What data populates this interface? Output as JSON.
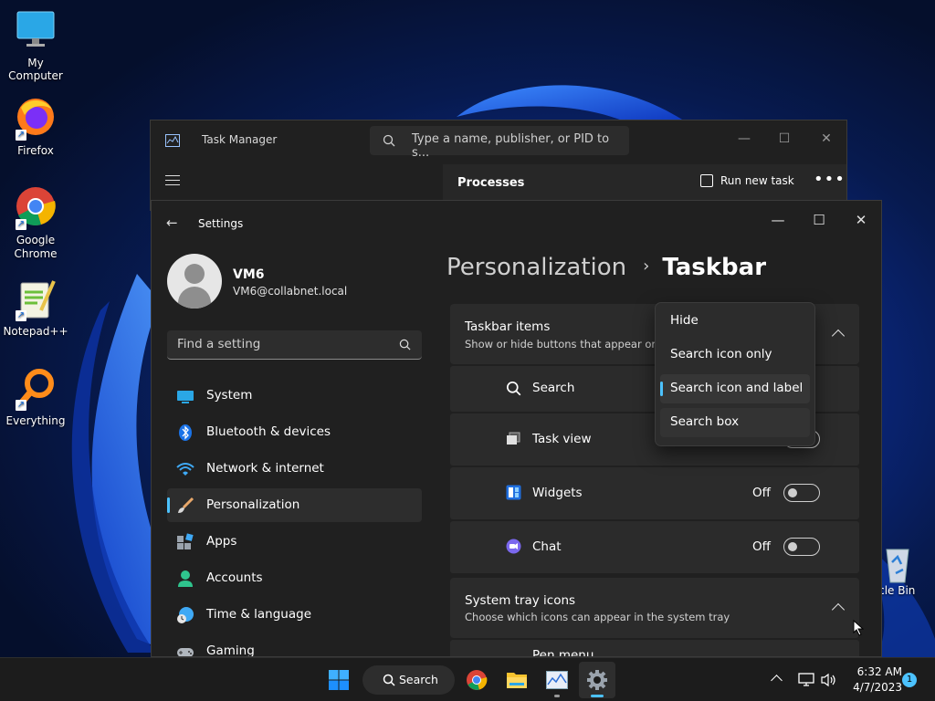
{
  "desktop": {
    "icons": [
      {
        "label": "My Computer",
        "icon": "monitor-icon"
      },
      {
        "label": "Firefox",
        "icon": "firefox-icon"
      },
      {
        "label": "Google\nChrome",
        "icon": "chrome-icon"
      },
      {
        "label": "Notepad++",
        "icon": "notepadpp-icon"
      },
      {
        "label": "Everything",
        "icon": "everything-icon"
      }
    ],
    "recycle_bin_label": "ycle Bin"
  },
  "task_manager": {
    "title": "Task Manager",
    "search_placeholder": "Type a name, publisher, or PID to s...",
    "page": "Processes",
    "run_new_task": "Run new task",
    "more": "•••"
  },
  "settings": {
    "title": "Settings",
    "user": {
      "name": "VM6",
      "email": "VM6@collabnet.local"
    },
    "find_placeholder": "Find a setting",
    "nav": [
      {
        "label": "System",
        "icon": "system-icon",
        "active": false
      },
      {
        "label": "Bluetooth & devices",
        "icon": "bluetooth-icon",
        "active": false
      },
      {
        "label": "Network & internet",
        "icon": "wifi-icon",
        "active": false
      },
      {
        "label": "Personalization",
        "icon": "brush-icon",
        "active": true
      },
      {
        "label": "Apps",
        "icon": "apps-icon",
        "active": false
      },
      {
        "label": "Accounts",
        "icon": "accounts-icon",
        "active": false
      },
      {
        "label": "Time & language",
        "icon": "globe-clock-icon",
        "active": false
      },
      {
        "label": "Gaming",
        "icon": "gamepad-icon",
        "active": false
      }
    ],
    "breadcrumb": {
      "parent": "Personalization",
      "separator": "›",
      "current": "Taskbar"
    },
    "taskbar_items": {
      "title": "Taskbar items",
      "subtitle": "Show or hide buttons that appear on t",
      "rows": [
        {
          "label": "Search",
          "icon": "search-icon",
          "state": "",
          "toggle": null
        },
        {
          "label": "Task view",
          "icon": "task-view-icon",
          "state": "",
          "toggle": "off"
        },
        {
          "label": "Widgets",
          "icon": "widgets-icon",
          "state": "Off",
          "toggle": "off"
        },
        {
          "label": "Chat",
          "icon": "chat-icon",
          "state": "Off",
          "toggle": "off"
        }
      ]
    },
    "system_tray": {
      "title": "System tray icons",
      "subtitle": "Choose which icons can appear in the system tray",
      "next_row_partial": "Pen menu"
    },
    "search_dropdown": {
      "options": [
        "Hide",
        "Search icon only",
        "Search icon and label",
        "Search box"
      ],
      "selected_index": 2,
      "hovered_index": 3
    }
  },
  "taskbar": {
    "search_label": "Search",
    "time": "6:32 AM",
    "date": "4/7/2023",
    "notification_count": "1"
  },
  "colors": {
    "accent": "#4cc2ff",
    "window_bg": "#202020",
    "card_bg": "#2b2b2b"
  }
}
